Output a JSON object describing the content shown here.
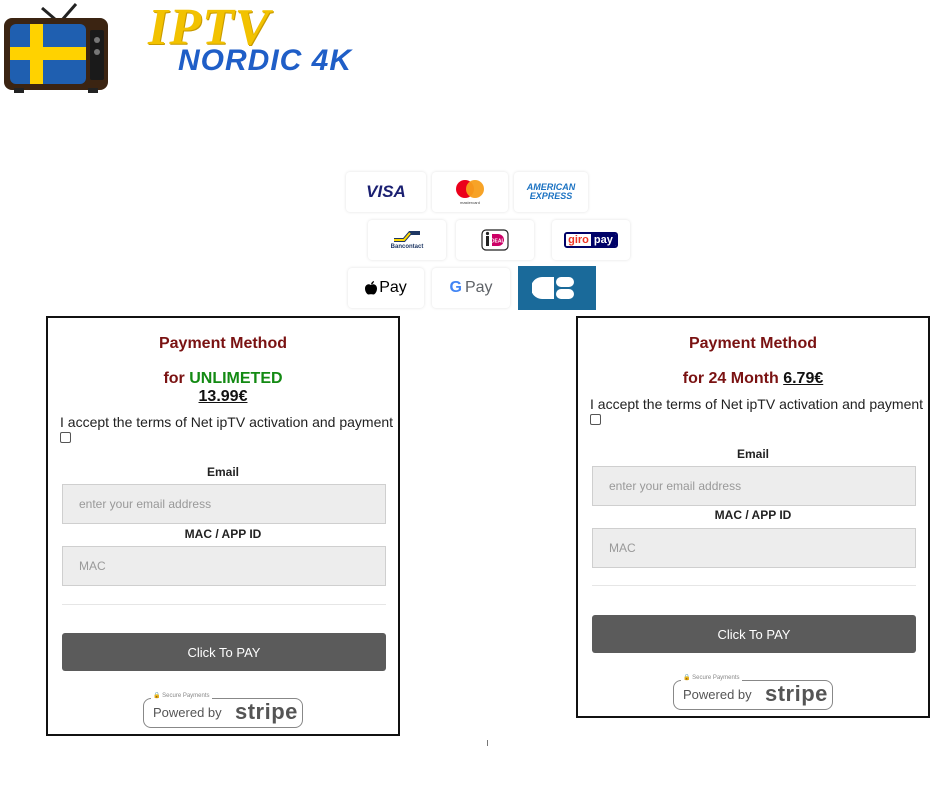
{
  "brand": {
    "logo_top": "IPTV",
    "logo_bottom": "NORDIC 4K",
    "flag_colors": {
      "blue": "#1f5fb0",
      "yellow": "#ffd200"
    }
  },
  "payment_methods": {
    "visa": "VISA",
    "mastercard_caption": "mastercard",
    "amex_line1": "AMERICAN",
    "amex_line2": "EXPRESS",
    "bancontact": "Bancontact",
    "ideal": "iDEAL",
    "giropay_a": "giro",
    "giropay_b": "pay",
    "applepay": "Pay",
    "googlepay_g": "G",
    "googlepay": "Pay",
    "cb": "CB"
  },
  "cards": [
    {
      "title": "Payment Method",
      "plan_prefix": "for",
      "plan_name": "UNLIMETED",
      "price": "13.99€",
      "terms": "I accept the terms of Net ipTV activation and payment",
      "email_label": "Email",
      "email_placeholder": "enter your email address",
      "mac_label": "MAC / APP ID",
      "mac_placeholder": "MAC",
      "pay_button": "Click To PAY",
      "stripe_secure": "Secure Payments",
      "stripe_powered": "Powered by",
      "stripe_word": "stripe"
    },
    {
      "title": "Payment Method",
      "plan_prefix": "for",
      "plan_name": "24 Month",
      "price": "6.79€",
      "terms": "I accept the terms of Net ipTV activation and payment",
      "email_label": "Email",
      "email_placeholder": "enter your email address",
      "mac_label": "MAC / APP ID",
      "mac_placeholder": "MAC",
      "pay_button": "Click To PAY",
      "stripe_secure": "Secure Payments",
      "stripe_powered": "Powered by",
      "stripe_word": "stripe"
    }
  ],
  "colors": {
    "title": "#7a1212",
    "plan_green": "#138a13",
    "button": "#5b5b5b",
    "field_bg": "#ededed"
  }
}
